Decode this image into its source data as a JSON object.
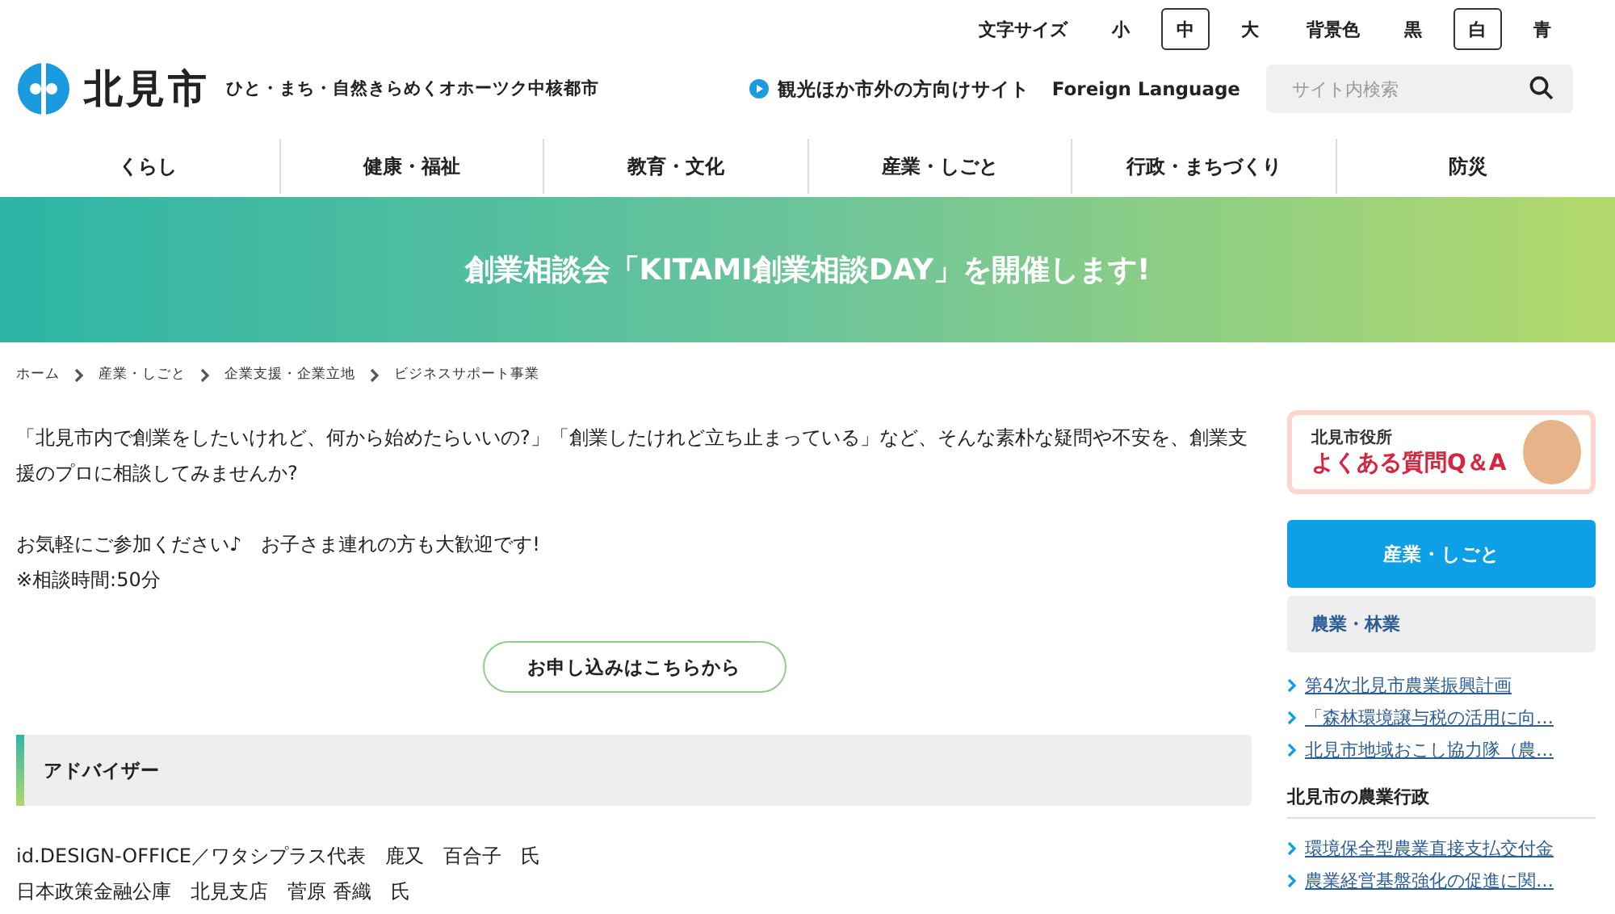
{
  "utility": {
    "text_size_label": "文字サイズ",
    "text_sizes": [
      {
        "label": "小",
        "selected": false
      },
      {
        "label": "中",
        "selected": true
      },
      {
        "label": "大",
        "selected": false
      }
    ],
    "bg_label": "背景色",
    "bg_colors": [
      {
        "label": "黒",
        "selected": false
      },
      {
        "label": "白",
        "selected": true
      },
      {
        "label": "青",
        "selected": false
      }
    ]
  },
  "header": {
    "logo_text": "北見市",
    "tagline": "ひと・まち・自然きらめくオホーツク中核都市",
    "tourism_link": "観光ほか市外の方向けサイト",
    "foreign_link": "Foreign Language",
    "search": {
      "placeholder": "サイト内検索"
    }
  },
  "nav": [
    "くらし",
    "健康・福祉",
    "教育・文化",
    "産業・しごと",
    "行政・まちづくり",
    "防災"
  ],
  "banner": {
    "title": "創業相談会「KITAMI創業相談DAY」を開催します!"
  },
  "breadcrumbs": [
    "ホーム",
    "産業・しごと",
    "企業支援・企業立地",
    "ビジネスサポート事業"
  ],
  "body": {
    "paragraphs": [
      "「北見市内で創業をしたいけれど、何から始めたらいいの?」「創業したけれど立ち止まっている」など、そんな素朴な疑問や不安を、創業支援のプロに相談してみませんか?",
      "お気軽にご参加ください♪　お子さま連れの方も大歓迎です!",
      "※相談時間:50分"
    ],
    "apply_button": "お申し込みはこちらから",
    "section_heading": "アドバイザー",
    "advisors": [
      "id.DESIGN-OFFICE／ワタシプラス代表　鹿又　百合子　氏",
      "日本政策金融公庫　北見支店　菅原 香織　氏"
    ]
  },
  "sidebar": {
    "faq_banner": {
      "line1": "北見市役所",
      "line2": "よくある質問Q＆A"
    },
    "category": "産業・しごと",
    "subcategory": "農業・林業",
    "links": [
      "第4次北見市農業振興計画",
      "「森林環境譲与税の活用に向…",
      "北見市地域おこし協力隊（農…"
    ],
    "section_title": "北見市の農業行政",
    "section_links": [
      "環境保全型農業直接支払交付金",
      "農業経営基盤強化の促進に関…"
    ]
  }
}
